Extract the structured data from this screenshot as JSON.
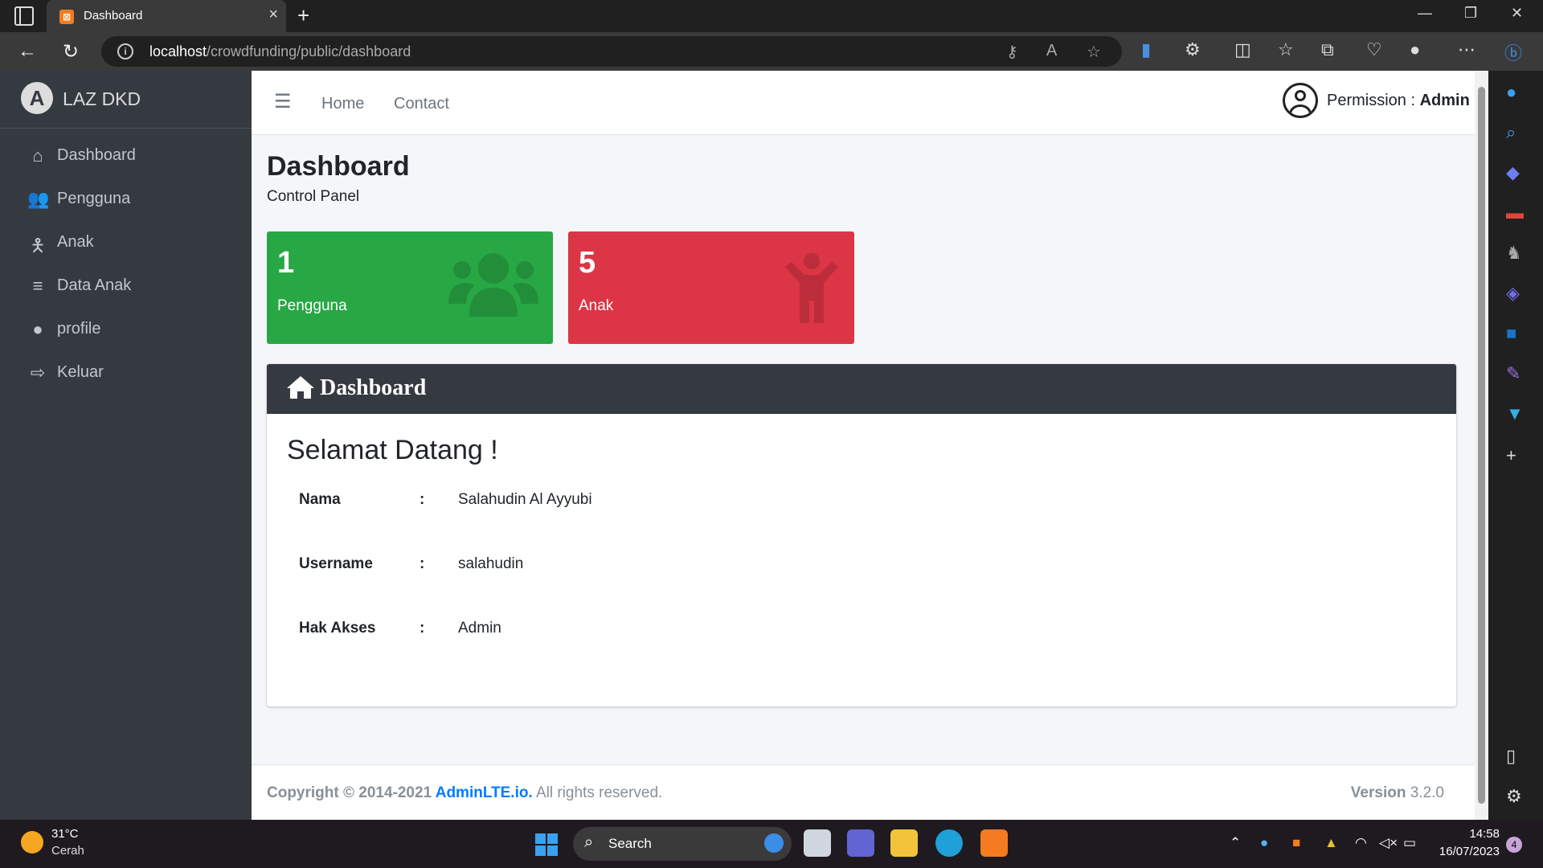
{
  "browser": {
    "tab_title": "Dashboard",
    "url_host": "localhost",
    "url_path": "/crowdfunding/public/dashboard"
  },
  "sidebar": {
    "brand": "LAZ DKD",
    "items": [
      {
        "label": "Dashboard",
        "icon": "home-icon"
      },
      {
        "label": "Pengguna",
        "icon": "users-icon"
      },
      {
        "label": "Anak",
        "icon": "child-icon"
      },
      {
        "label": "Data Anak",
        "icon": "database-icon"
      },
      {
        "label": "profile",
        "icon": "user-icon"
      },
      {
        "label": "Keluar",
        "icon": "sign-out-icon"
      }
    ]
  },
  "navbar": {
    "links": [
      "Home",
      "Contact"
    ],
    "permission_label": "Permission :",
    "permission_value": "Admin"
  },
  "page": {
    "title": "Dashboard",
    "subtitle": "Control Panel"
  },
  "stats": [
    {
      "value": "1",
      "label": "Pengguna",
      "color": "#28a745",
      "icon": "users-icon"
    },
    {
      "value": "5",
      "label": "Anak",
      "color": "#dc3545",
      "icon": "child-icon"
    }
  ],
  "card": {
    "title": "Dashboard",
    "welcome": "Selamat Datang !",
    "rows": [
      {
        "label": "Nama",
        "value": "Salahudin Al Ayyubi"
      },
      {
        "label": "Username",
        "value": "salahudin"
      },
      {
        "label": "Hak Akses",
        "value": "Admin"
      }
    ]
  },
  "footer": {
    "copyright_prefix": "Copyright © 2014-2021 ",
    "copyright_link": "AdminLTE.io.",
    "copyright_suffix": " All rights reserved.",
    "version_label": "Version",
    "version_value": "3.2.0"
  },
  "taskbar": {
    "temperature": "31°C",
    "weather": "Cerah",
    "search": "Search",
    "time": "14:58",
    "date": "16/07/2023",
    "notifications": "4"
  }
}
